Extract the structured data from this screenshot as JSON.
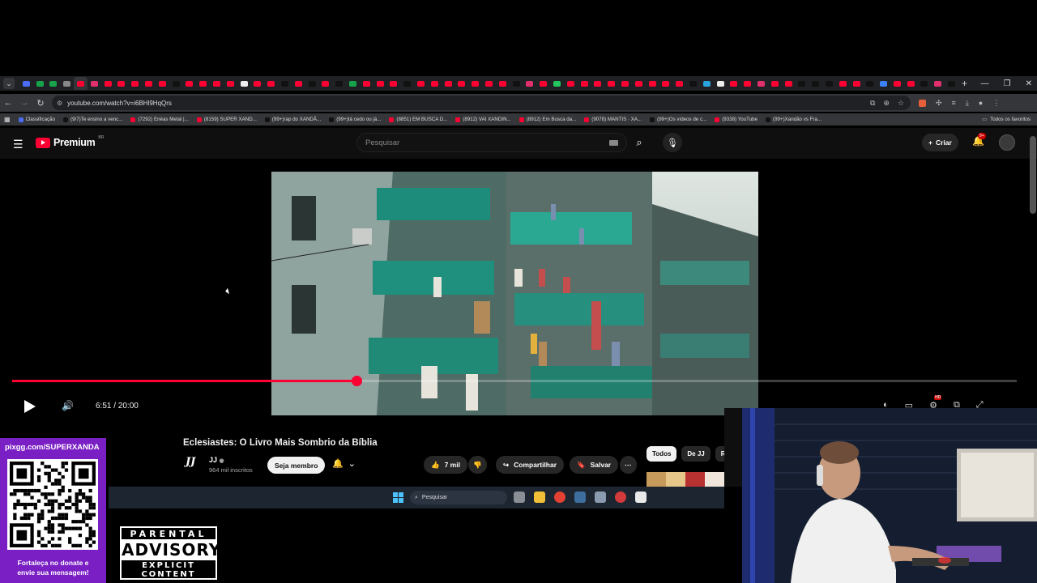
{
  "browser": {
    "url": "youtube.com/watch?v=i6BHl9HqQrs",
    "bookmarks": [
      {
        "label": "Classificação",
        "color": "#4a6cf7"
      },
      {
        "label": "(9/7)Te ensino a venc...",
        "color": "#111111"
      },
      {
        "label": "(7292) Enéas Metal |...",
        "color": "#ff0033"
      },
      {
        "label": "(8159) SUPER XAND...",
        "color": "#ff0033"
      },
      {
        "label": "(99+)rap do XANDÃ...",
        "color": "#111111"
      },
      {
        "label": "(99+)tá cedo ou já...",
        "color": "#111111"
      },
      {
        "label": "(8851) EM BUSCA D...",
        "color": "#ff0033"
      },
      {
        "label": "(8912) VAI XANDIN...",
        "color": "#ff0033"
      },
      {
        "label": "(8912) Em Busca da...",
        "color": "#ff0033"
      },
      {
        "label": "(9078) MANTIS · XA...",
        "color": "#ff0033"
      },
      {
        "label": "(99+)Os vídeos de c...",
        "color": "#111111"
      },
      {
        "label": "(9338) YouTube",
        "color": "#ff0033"
      },
      {
        "label": "(99+)Xandão vs Fra...",
        "color": "#111111"
      }
    ],
    "all_favorites": "Todos os favoritos"
  },
  "youtube": {
    "logo_text": "Premium",
    "logo_region": "BR",
    "search_placeholder": "Pesquisar",
    "create_label": "Criar",
    "notification_badge": "9+",
    "hd_badge": "HD"
  },
  "player": {
    "current_time": "6:51",
    "duration": "20:00",
    "time_display": "6:51 / 20:00",
    "progress_fraction": 0.3425
  },
  "video": {
    "title": "Eclesiastes: O Livro Mais Sombrio da Bíblia",
    "channel_logo": "JJ",
    "channel_name": "JJ",
    "subscribers": "964 mil inscritos",
    "join_label": "Seja membro",
    "likes": "7 mil",
    "share_label": "Compartilhar",
    "save_label": "Salvar"
  },
  "chips": [
    "Todos",
    "De JJ",
    "R"
  ],
  "taskbar": {
    "search_placeholder": "Pesquisar"
  },
  "donation": {
    "url": "pixgg.com/SUPERXANDA",
    "message_line1": "Fortaleça no donate e",
    "message_line2": "envie sua mensagem!"
  },
  "parental_advisory": {
    "line1": "PARENTAL",
    "line2": "ADVISORY",
    "line3": "EXPLICIT CONTENT"
  },
  "colors": {
    "accent": "#ff0033",
    "background": "#0f0f0f",
    "donation_panel": "#7a1fc4"
  }
}
